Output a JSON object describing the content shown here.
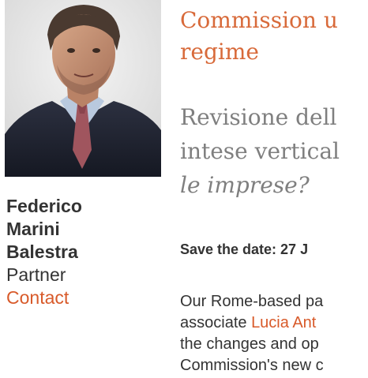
{
  "profile": {
    "photo_icon": "portrait-photo",
    "name_lines": [
      "Federico",
      "Marini",
      "Balestra"
    ],
    "role": "Partner",
    "contact_label": "Contact"
  },
  "article": {
    "headline": "Commission u\nregime",
    "subhead_lines": [
      "Revisione dell",
      "intese vertical"
    ],
    "subhead_italic": "le imprese?",
    "save_the_date": "Save the date: 27 J",
    "body": {
      "line1": "Our Rome-based pa",
      "line2_prefix": "associate ",
      "line2_link": "Lucia Ant",
      "line3": "the changes and op",
      "line4": "Commission's new c"
    }
  },
  "colors": {
    "accent": "#d85a2a",
    "headline": "#d86a3a",
    "subhead": "#7f7f7f",
    "text": "#333333"
  }
}
